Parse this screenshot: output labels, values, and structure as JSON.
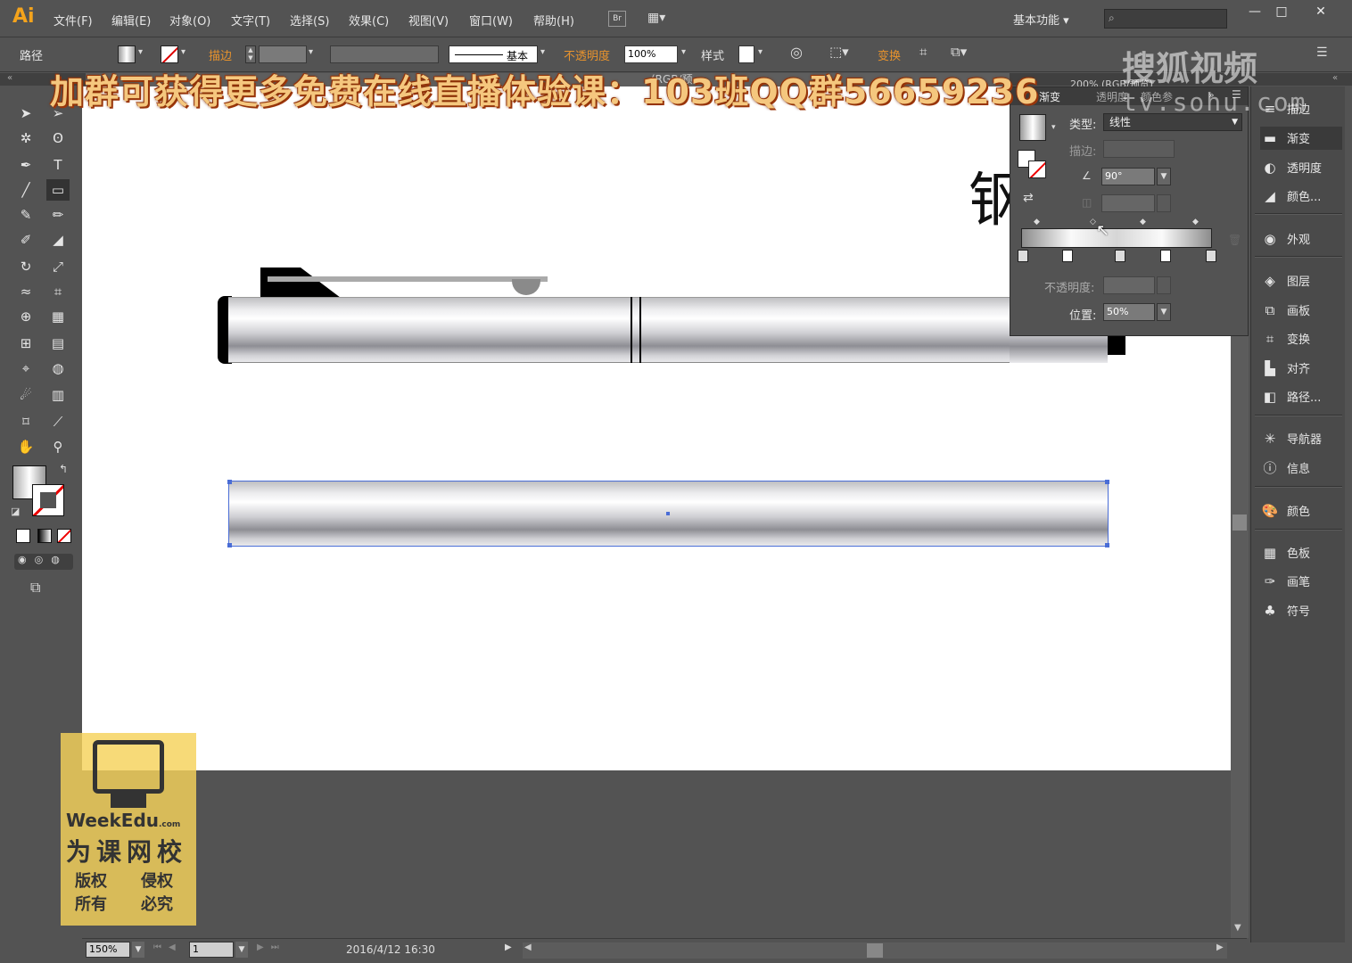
{
  "app": {
    "logo": "Ai"
  },
  "menu": [
    "文件(F)",
    "编辑(E)",
    "对象(O)",
    "文字(T)",
    "选择(S)",
    "效果(C)",
    "视图(V)",
    "窗口(W)",
    "帮助(H)"
  ],
  "menu_extra": {
    "bridge": "Br",
    "workspace": "基本功能",
    "search_placeholder": ""
  },
  "window_controls": {
    "minimize": "—",
    "maximize": "□",
    "close": "✕"
  },
  "control_bar": {
    "selection_label": "路径",
    "stroke_label": "描边",
    "stroke_style": "基本",
    "opacity_label": "不透明度",
    "opacity_value": "100%",
    "style_label": "样式",
    "transform_label": "变换"
  },
  "banner": "加群可获得更多免费在线直播体验课：103班QQ群56659236",
  "watermark": {
    "line1": "搜狐视频",
    "line2": "tv.sohu.com"
  },
  "doc_tab_fragment": "(RGB/预",
  "doc_tab_fragment2": "200% (RGB/预览)",
  "canvas_text": "钢",
  "gradient_panel": {
    "tabs": [
      "渐变",
      "透明度",
      "颜色参"
    ],
    "type_label": "类型:",
    "type_value": "线性",
    "stroke_label": "描边:",
    "angle_value": "90°",
    "opacity_label": "不透明度:",
    "position_label": "位置:",
    "position_value": "50%"
  },
  "right_dock": {
    "group1": [
      "描边",
      "渐变",
      "透明度",
      "颜色..."
    ],
    "group2": [
      "外观"
    ],
    "group3": [
      "图层",
      "画板",
      "变换",
      "对齐",
      "路径..."
    ],
    "group4": [
      "导航器",
      "信息"
    ],
    "group5": [
      "颜色"
    ],
    "group6": [
      "色板",
      "画笔",
      "符号"
    ]
  },
  "status_bar": {
    "zoom": "150%",
    "artboard": "1",
    "datetime": "2016/4/12    16:30"
  },
  "school_mark": {
    "brand": "WeekEdu",
    "brand_suffix": ".com",
    "name": "为课网校",
    "c1": "版权",
    "c2": "所有",
    "c3": "侵权",
    "c4": "必究"
  },
  "colors": {
    "accent_orange": "#f4a31c",
    "selection_blue": "#4a6dd6"
  }
}
